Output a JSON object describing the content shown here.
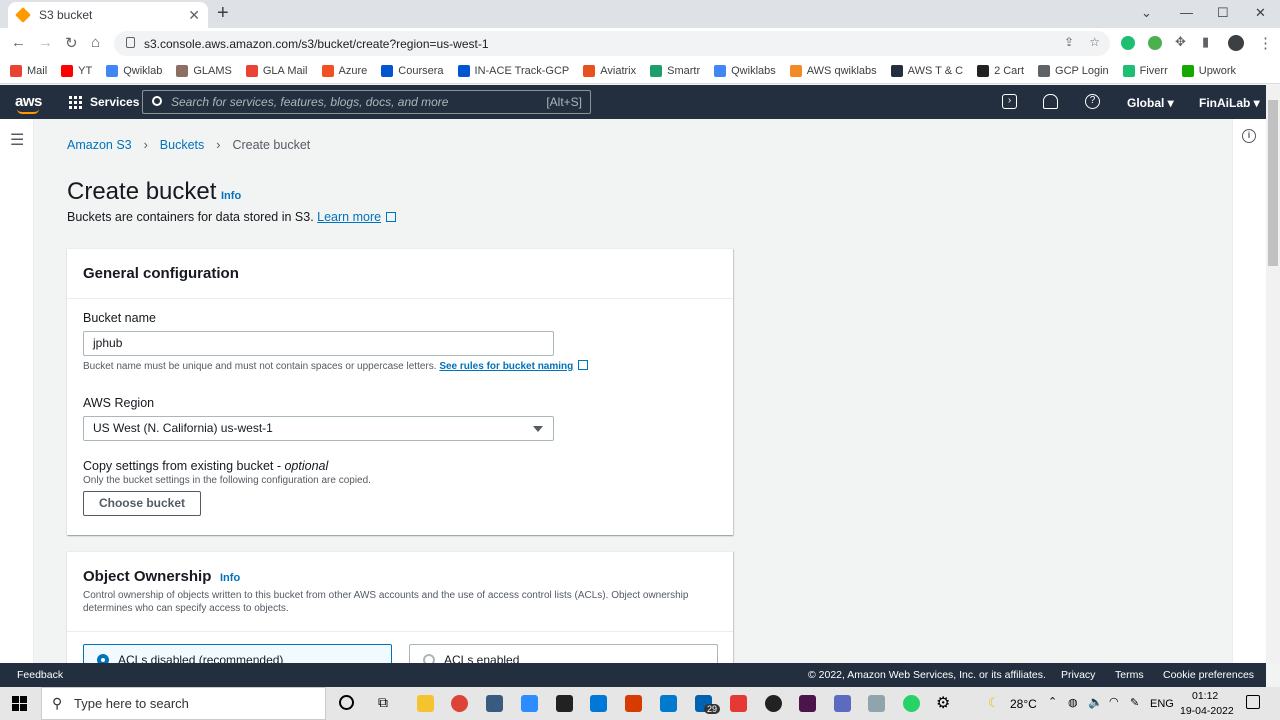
{
  "browser": {
    "tab_title": "S3 bucket",
    "url": "s3.console.aws.amazon.com/s3/bucket/create?region=us-west-1",
    "bookmarks": [
      {
        "label": "Mail",
        "color": "#ea4335"
      },
      {
        "label": "YT",
        "color": "#ff0000"
      },
      {
        "label": "Qwiklab",
        "color": "#4285f4"
      },
      {
        "label": "GLAMS",
        "color": "#8d6e63"
      },
      {
        "label": "GLA Mail",
        "color": "#ea4335"
      },
      {
        "label": "Azure",
        "color": "#f25022"
      },
      {
        "label": "Coursera",
        "color": "#0056d2"
      },
      {
        "label": "IN-ACE Track-GCP",
        "color": "#0056d2"
      },
      {
        "label": "Aviatrix",
        "color": "#e8501f"
      },
      {
        "label": "Smartr",
        "color": "#1e9e6a"
      },
      {
        "label": "Qwiklabs",
        "color": "#4285f4"
      },
      {
        "label": "AWS qwiklabs",
        "color": "#f28b27"
      },
      {
        "label": "AWS T & C",
        "color": "#232f3e"
      },
      {
        "label": "2 Cart",
        "color": "#222222"
      },
      {
        "label": "GCP Login",
        "color": "#5f6368"
      },
      {
        "label": "Fiverr",
        "color": "#1dbf73"
      },
      {
        "label": "Upwork",
        "color": "#14a800"
      }
    ]
  },
  "aws_header": {
    "logo": "aws",
    "services": "Services",
    "search_placeholder": "Search for services, features, blogs, docs, and more",
    "search_shortcut": "[Alt+S]",
    "region": "Global",
    "account": "FinAiLab"
  },
  "breadcrumb": [
    "Amazon S3",
    "Buckets",
    "Create bucket"
  ],
  "page": {
    "title": "Create bucket",
    "info": "Info",
    "description": "Buckets are containers for data stored in S3.",
    "learn_more": "Learn more"
  },
  "general_config": {
    "heading": "General configuration",
    "bucket_name_label": "Bucket name",
    "bucket_name_value": "jphub",
    "bucket_name_hint": "Bucket name must be unique and must not contain spaces or uppercase letters.",
    "bucket_name_rules_link": "See rules for bucket naming",
    "region_label": "AWS Region",
    "region_value": "US West (N. California) us-west-1",
    "copy_label": "Copy settings from existing bucket -",
    "copy_optional": "optional",
    "copy_hint": "Only the bucket settings in the following configuration are copied.",
    "choose_bucket": "Choose bucket"
  },
  "object_ownership": {
    "heading": "Object Ownership",
    "info": "Info",
    "description": "Control ownership of objects written to this bucket from other AWS accounts and the use of access control lists (ACLs). Object ownership determines who can specify access to objects.",
    "option_disabled": "ACLs disabled (recommended)",
    "option_enabled": "ACLs enabled"
  },
  "footer": {
    "feedback": "Feedback",
    "copyright": "© 2022, Amazon Web Services, Inc. or its affiliates.",
    "privacy": "Privacy",
    "terms": "Terms",
    "cookie": "Cookie preferences"
  },
  "taskbar": {
    "search_placeholder": "Type here to search",
    "weather": "28°C",
    "lang": "ENG",
    "time": "01:12",
    "date": "19-04-2022",
    "badge": "29"
  }
}
